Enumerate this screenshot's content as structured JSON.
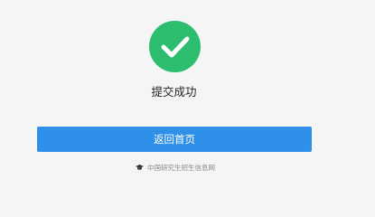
{
  "status": {
    "icon": "checkmark-icon",
    "icon_color": "#2dbd6e",
    "message": "提交成功"
  },
  "actions": {
    "back_home_label": "返回首页",
    "button_color": "#2e90e8"
  },
  "footer": {
    "logo_icon": "graduation-cap-icon",
    "site_name": "中国研究生招生信息网"
  }
}
